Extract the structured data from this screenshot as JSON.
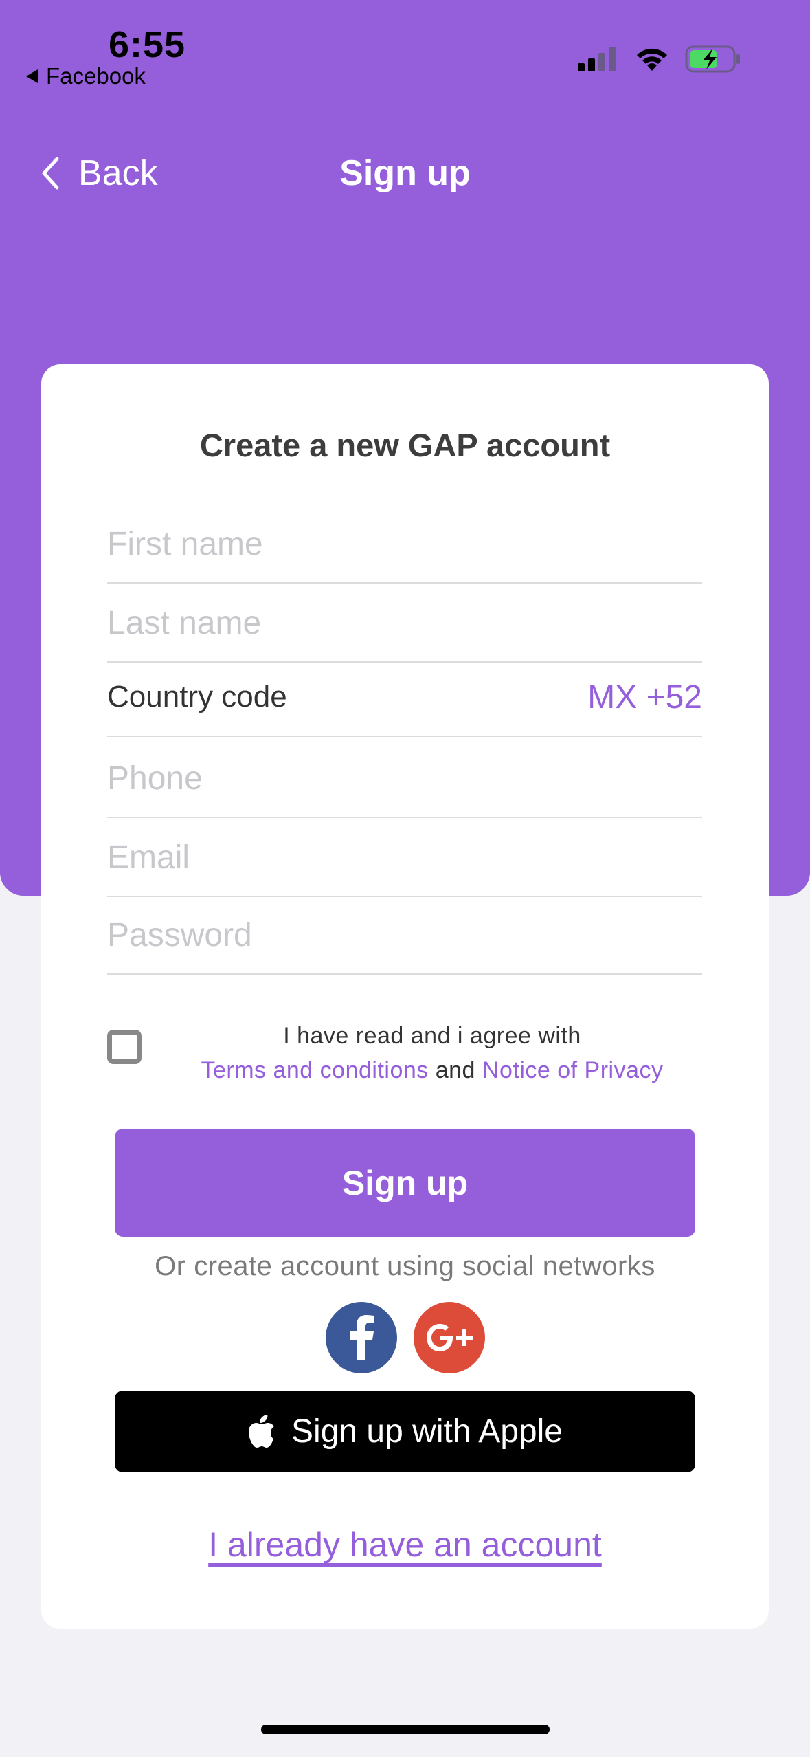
{
  "status_bar": {
    "time": "6:55",
    "back_app": "Facebook",
    "signal_icon": "cellular-signal-icon",
    "wifi_icon": "wifi-icon",
    "battery_icon": "battery-charging-icon"
  },
  "nav": {
    "back_label": "Back",
    "title": "Sign up"
  },
  "form": {
    "heading": "Create a new GAP account",
    "first_name": {
      "placeholder": "First name",
      "value": ""
    },
    "last_name": {
      "placeholder": "Last name",
      "value": ""
    },
    "country_code": {
      "label": "Country code",
      "value": "MX +52"
    },
    "phone": {
      "placeholder": "Phone",
      "value": ""
    },
    "email": {
      "placeholder": "Email",
      "value": ""
    },
    "password": {
      "placeholder": "Password",
      "value": ""
    },
    "agree": {
      "checked": false,
      "text": "I have read and i agree with",
      "terms_link": "Terms and conditions",
      "conjunction": "and",
      "privacy_link": "Notice of Privacy"
    },
    "signup_button": "Sign up",
    "social_text": "Or create account using social networks",
    "social": [
      "facebook-icon",
      "google-plus-icon"
    ],
    "apple_button": "Sign up with Apple",
    "already_account_link": "I already have an account"
  },
  "colors": {
    "accent": "#955fdb",
    "background": "#f2f1f6",
    "facebook": "#3b5998",
    "google": "#dd4b39"
  }
}
